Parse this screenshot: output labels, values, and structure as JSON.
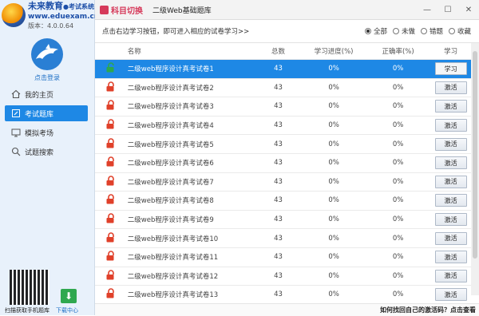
{
  "brand": {
    "name": "未来教育",
    "system": "●考试系统",
    "url": "www.eduexam.cn",
    "version": "版本：4.0.0.64"
  },
  "sidebar": {
    "login_label": "点击登录",
    "items": [
      {
        "label": "我的主页",
        "icon": "home-icon"
      },
      {
        "label": "考试题库",
        "icon": "pencil-icon",
        "active": true
      },
      {
        "label": "模拟考场",
        "icon": "monitor-icon"
      },
      {
        "label": "试题搜索",
        "icon": "search-icon"
      }
    ],
    "qr_caption": "扫描获取手机题库",
    "download_caption": "下载中心"
  },
  "header": {
    "subject_switch": "科目切换",
    "bank_title": "二级Web基础题库"
  },
  "toolbar": {
    "hint": "点击右边学习按钮，即可进入相应的试卷学习>>",
    "filters": [
      {
        "label": "全部",
        "checked": true
      },
      {
        "label": "未做",
        "checked": false
      },
      {
        "label": "错题",
        "checked": false
      },
      {
        "label": "收藏",
        "checked": false
      }
    ]
  },
  "table": {
    "columns": {
      "name": "名称",
      "total": "总数",
      "progress": "学习进度(%)",
      "accuracy": "正确率(%)",
      "study": "学习"
    },
    "rows": [
      {
        "name": "二级web程序设计真考试卷1",
        "total": "43",
        "progress": "0%",
        "accuracy": "0%",
        "action": "学习",
        "unlocked": true,
        "selected": true
      },
      {
        "name": "二级web程序设计真考试卷2",
        "total": "43",
        "progress": "0%",
        "accuracy": "0%",
        "action": "激活"
      },
      {
        "name": "二级web程序设计真考试卷3",
        "total": "43",
        "progress": "0%",
        "accuracy": "0%",
        "action": "激活"
      },
      {
        "name": "二级web程序设计真考试卷4",
        "total": "43",
        "progress": "0%",
        "accuracy": "0%",
        "action": "激活"
      },
      {
        "name": "二级web程序设计真考试卷5",
        "total": "43",
        "progress": "0%",
        "accuracy": "0%",
        "action": "激活"
      },
      {
        "name": "二级web程序设计真考试卷6",
        "total": "43",
        "progress": "0%",
        "accuracy": "0%",
        "action": "激活"
      },
      {
        "name": "二级web程序设计真考试卷7",
        "total": "43",
        "progress": "0%",
        "accuracy": "0%",
        "action": "激活"
      },
      {
        "name": "二级web程序设计真考试卷8",
        "total": "43",
        "progress": "0%",
        "accuracy": "0%",
        "action": "激活"
      },
      {
        "name": "二级web程序设计真考试卷9",
        "total": "43",
        "progress": "0%",
        "accuracy": "0%",
        "action": "激活"
      },
      {
        "name": "二级web程序设计真考试卷10",
        "total": "43",
        "progress": "0%",
        "accuracy": "0%",
        "action": "激活"
      },
      {
        "name": "二级web程序设计真考试卷11",
        "total": "43",
        "progress": "0%",
        "accuracy": "0%",
        "action": "激活"
      },
      {
        "name": "二级web程序设计真考试卷12",
        "total": "43",
        "progress": "0%",
        "accuracy": "0%",
        "action": "激活"
      },
      {
        "name": "二级web程序设计真考试卷13",
        "total": "43",
        "progress": "0%",
        "accuracy": "0%",
        "action": "激活"
      }
    ]
  },
  "footer": {
    "help": "如何找回自己的激活码？点击查看"
  },
  "colors": {
    "accent": "#1e88e5",
    "lock": "#e0402a",
    "unlock": "#2da84f",
    "subject": "#d63a5a"
  }
}
